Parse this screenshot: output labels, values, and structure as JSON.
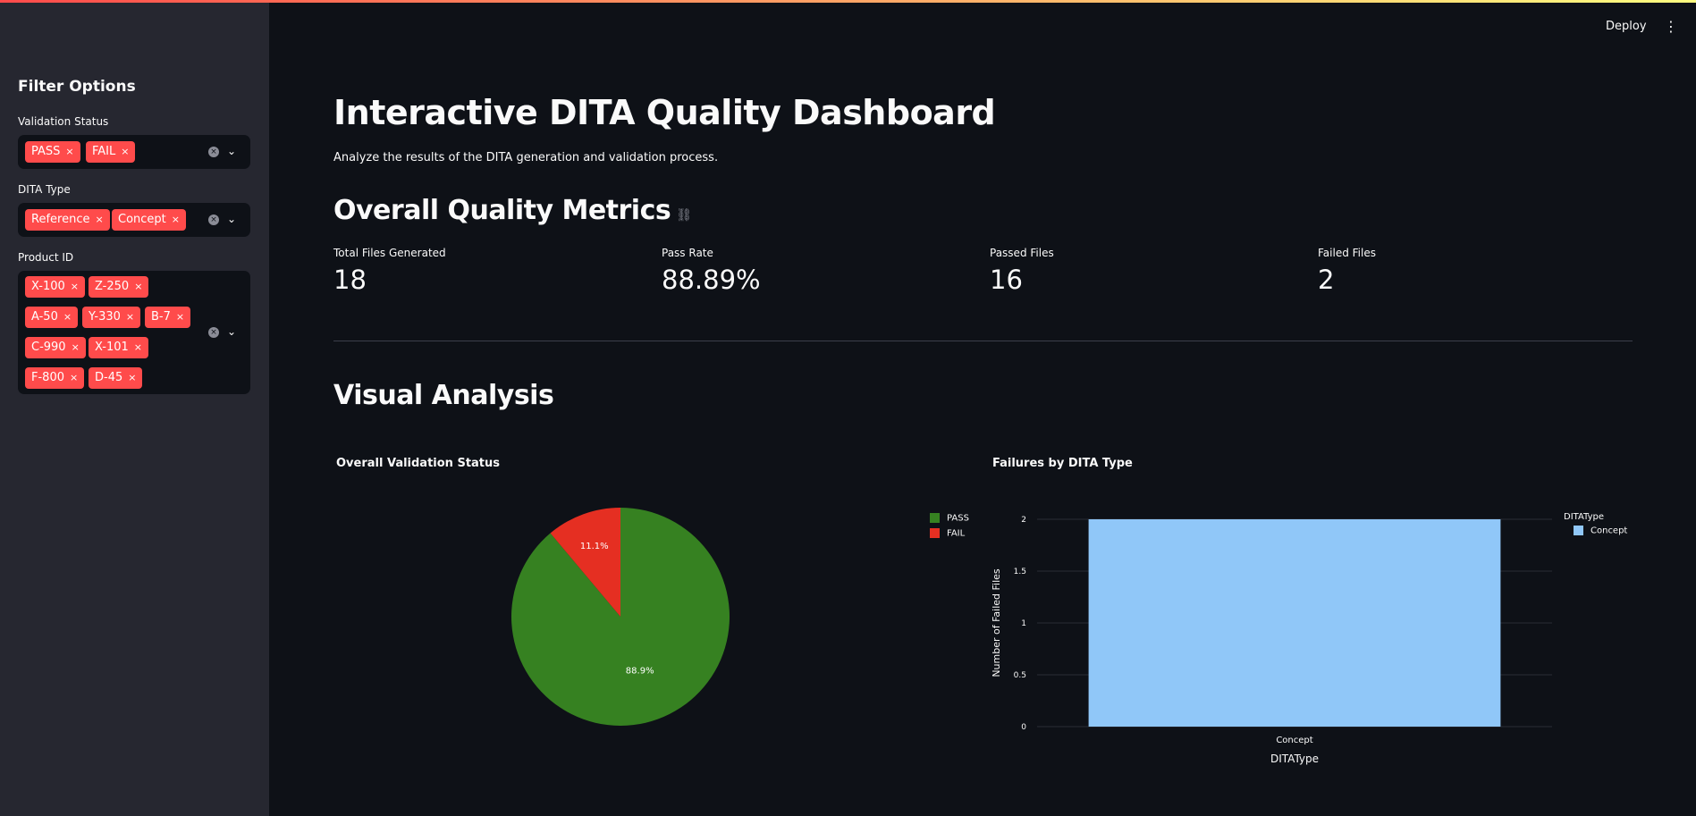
{
  "header": {
    "deploy_label": "Deploy",
    "menu_icon": "kebab-icon"
  },
  "sidebar": {
    "title": "Filter Options",
    "filters": [
      {
        "label": "Validation Status",
        "tags": [
          "PASS",
          "FAIL"
        ]
      },
      {
        "label": "DITA Type",
        "tags": [
          "Reference",
          "Concept"
        ]
      },
      {
        "label": "Product ID",
        "tags": [
          "X-100",
          "Z-250",
          "A-50",
          "Y-330",
          "B-7",
          "C-990",
          "X-101",
          "F-800",
          "D-45"
        ]
      }
    ],
    "tag_remove_glyph": "×",
    "clear_glyph": "×",
    "chevron_glyph": "⌄"
  },
  "main": {
    "title": "Interactive DITA Quality Dashboard",
    "subtitle": "Analyze the results of the DITA generation and validation process.",
    "metrics_heading": "Overall Quality Metrics",
    "metrics": [
      {
        "label": "Total Files Generated",
        "value": "18"
      },
      {
        "label": "Pass Rate",
        "value": "88.89%"
      },
      {
        "label": "Passed Files",
        "value": "16"
      },
      {
        "label": "Failed Files",
        "value": "2"
      }
    ],
    "visual_heading": "Visual Analysis"
  },
  "colors": {
    "accent": "#ff4b4b",
    "pass": "#368121",
    "fail": "#e52f22",
    "bar": "#90c7f8"
  },
  "chart_data": [
    {
      "type": "pie",
      "title": "Overall Validation Status",
      "labels": [
        "PASS",
        "FAIL"
      ],
      "values": [
        16,
        2
      ],
      "percent_labels": [
        "88.9%",
        "11.1%"
      ],
      "colors": [
        "#368121",
        "#e52f22"
      ],
      "legend": "right"
    },
    {
      "type": "bar",
      "title": "Failures by DITA Type",
      "categories": [
        "Concept"
      ],
      "series": [
        {
          "name": "Concept",
          "values": [
            2
          ]
        }
      ],
      "xlabel": "DITAType",
      "ylabel": "Number of Failed Files",
      "ylim": [
        0,
        2
      ],
      "yticks": [
        "0",
        "0.5",
        "1",
        "1.5",
        "2"
      ],
      "legend_title": "DITAType",
      "legend": "right",
      "grid": true
    }
  ]
}
